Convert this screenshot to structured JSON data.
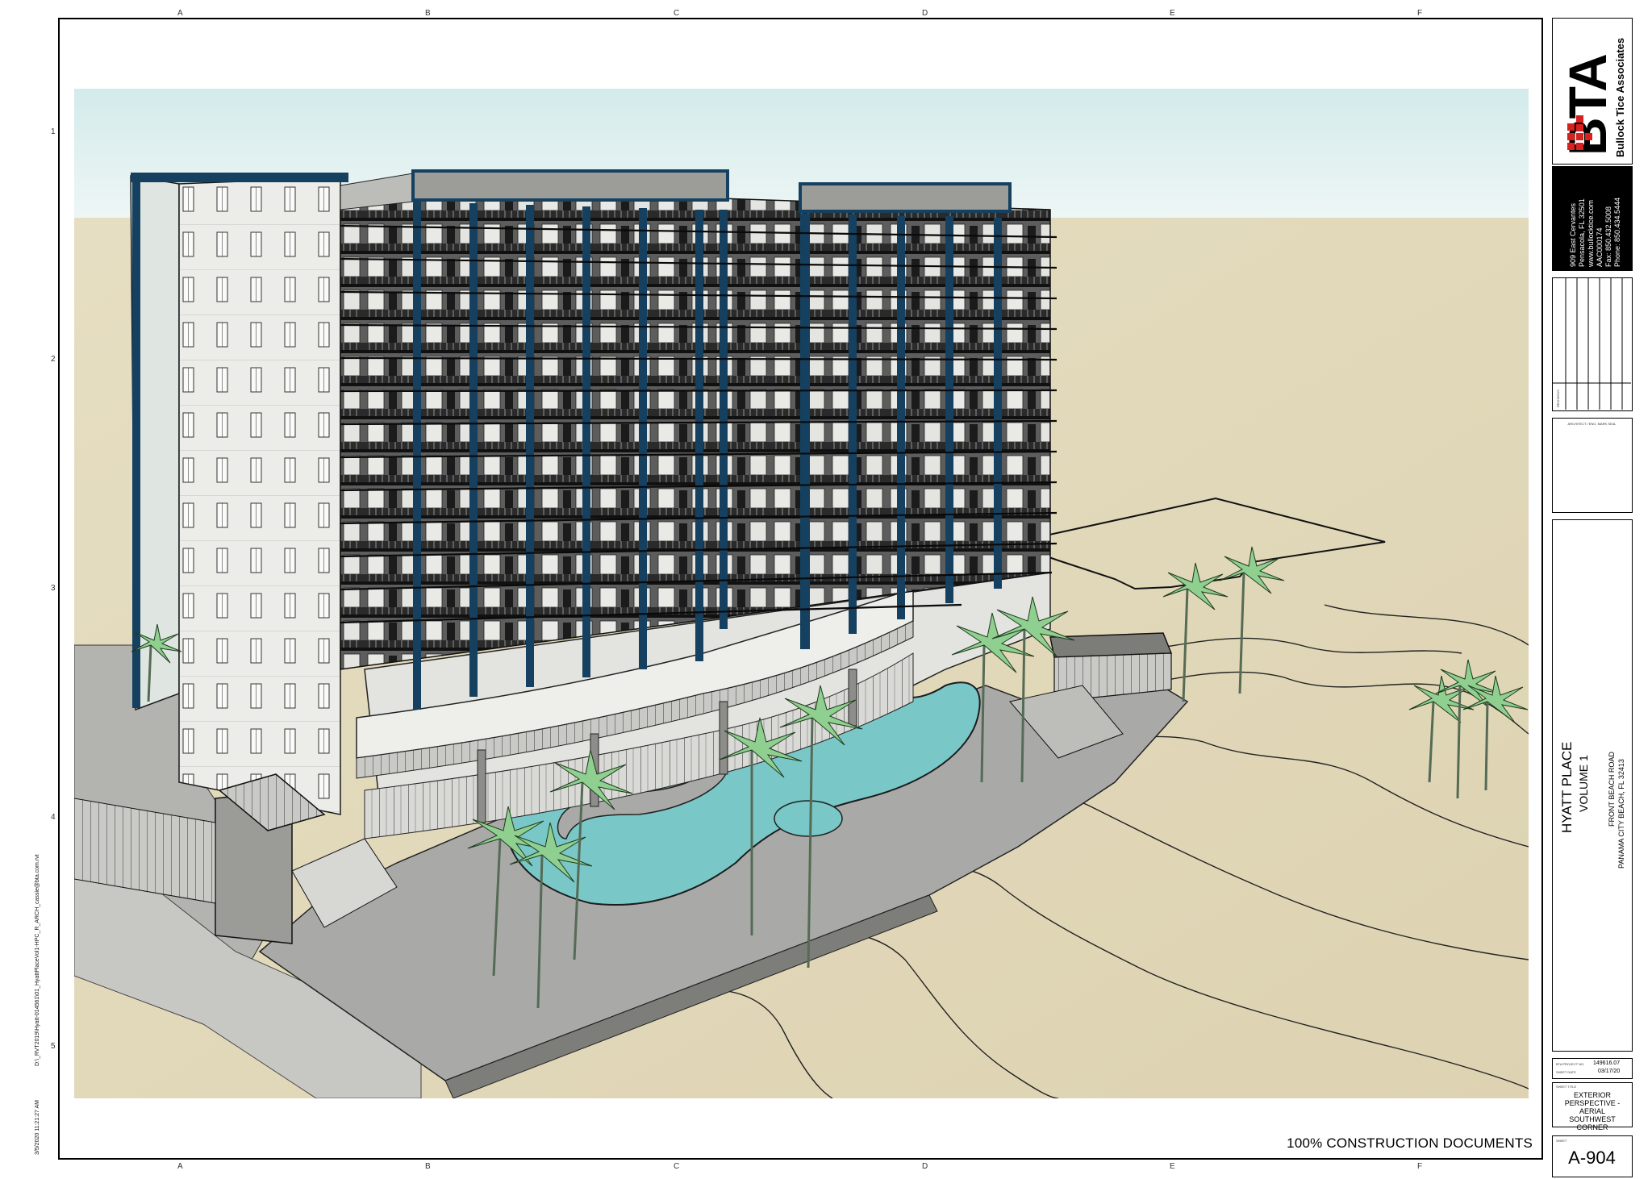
{
  "grid": {
    "columns": [
      "A",
      "B",
      "C",
      "D",
      "E",
      "F"
    ],
    "rows": [
      "1",
      "2",
      "3",
      "4",
      "5"
    ]
  },
  "side_text": {
    "file_path": "D:\\_RVT2019\\Hyatt-014561\\01_HyattPlaceVol1-HPC_R_ARCH_cassie@bta.com.rvt",
    "plot_date": "3/5/2020 11:21:27 AM"
  },
  "firm": {
    "logo_letters": "BTA",
    "name": "Bullock Tice Associates",
    "address": [
      "909 East Cervantes",
      "Pensacola, FL 32501",
      "www.bullocktice.com",
      "AAC000174",
      "Fax: 850.432.5008",
      "Phone: 850.434.5444"
    ]
  },
  "title_block": {
    "revisions_label": "REVISIONS",
    "seal_label": "ARCHITECT / ENG. MARK SEAL",
    "project_name": "HYATT PLACE",
    "project_volume": "VOLUME 1",
    "project_address_1": "FRONT BEACH ROAD",
    "project_address_2": "PANAMA CITY BEACH, FL 32413",
    "project_no_label": "BTA PROJECT NO.",
    "project_no": "149616.07",
    "sheet_date_label": "SHEET DATE",
    "sheet_date": "03/17/20",
    "sheet_title_label": "SHEET TITLE",
    "sheet_title": "EXTERIOR PERSPECTIVE - AERIAL SOUTHWEST CORNER",
    "sheet_label": "SHEET",
    "sheet_number": "A-904"
  },
  "footer": {
    "status": "100% CONSTRUCTION DOCUMENTS"
  },
  "colors": {
    "sky_top": "#d6ecec",
    "sand": "#e3dbbe",
    "pool": "#78c7c7",
    "facade_white": "#efefec",
    "balcony_dark": "#3a3a3a",
    "accent_blue": "#15405f",
    "deck_gray": "#a8a8a6",
    "logo_red": "#d8201e",
    "palm_green": "#8fcf8f"
  }
}
